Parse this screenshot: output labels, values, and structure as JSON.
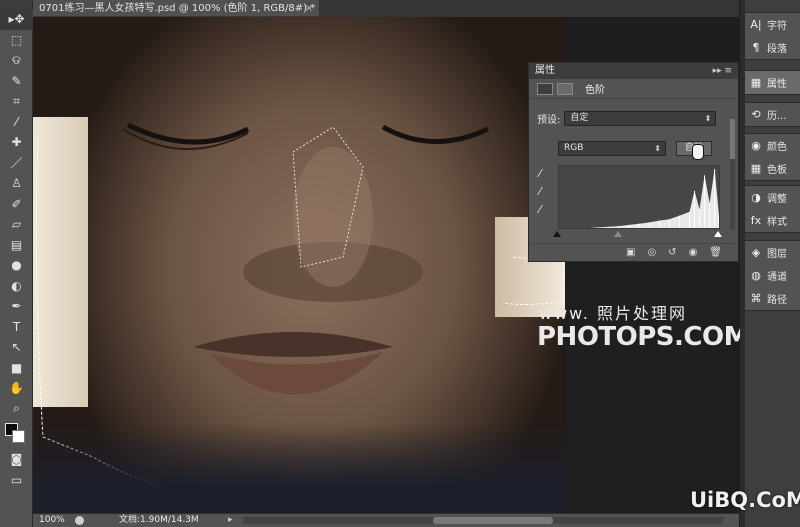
{
  "document": {
    "tab_title": "0701练习—黑人女孩特写.psd @ 100% (色阶 1, RGB/8#) *",
    "close": "×"
  },
  "tools": [
    {
      "icon": "move-icon",
      "glyph": "▸✥"
    },
    {
      "icon": "marquee-icon",
      "glyph": "⬚"
    },
    {
      "icon": "lasso-icon",
      "glyph": "ଡ"
    },
    {
      "icon": "quick-select-icon",
      "glyph": "✎"
    },
    {
      "icon": "crop-icon",
      "glyph": "⌗"
    },
    {
      "icon": "eyedropper-icon",
      "glyph": "⁄"
    },
    {
      "icon": "healing-brush-icon",
      "glyph": "✚"
    },
    {
      "icon": "brush-icon",
      "glyph": "／"
    },
    {
      "icon": "clone-stamp-icon",
      "glyph": "♙"
    },
    {
      "icon": "history-brush-icon",
      "glyph": "✐"
    },
    {
      "icon": "eraser-icon",
      "glyph": "▱"
    },
    {
      "icon": "gradient-icon",
      "glyph": "▤"
    },
    {
      "icon": "blur-icon",
      "glyph": "●"
    },
    {
      "icon": "dodge-icon",
      "glyph": "◐"
    },
    {
      "icon": "pen-icon",
      "glyph": "✒"
    },
    {
      "icon": "type-icon",
      "glyph": "T"
    },
    {
      "icon": "path-select-icon",
      "glyph": "↖"
    },
    {
      "icon": "shape-icon",
      "glyph": "■"
    },
    {
      "icon": "hand-icon",
      "glyph": "✋"
    },
    {
      "icon": "zoom-icon",
      "glyph": "⌕"
    }
  ],
  "extra_tools": [
    {
      "icon": "quick-mask-icon",
      "glyph": "◙"
    },
    {
      "icon": "screen-mode-icon",
      "glyph": "▭"
    }
  ],
  "status": {
    "zoom": "100%",
    "doc_info": "文档:1.90M/14.3M",
    "arrow": "▸"
  },
  "properties": {
    "title": "属性",
    "controls": "▸▸ ≡",
    "type_label": "色阶",
    "preset_label": "预设:",
    "preset_value": "自定",
    "channel_value": "RGB",
    "auto_label": "自动",
    "footer_icons": [
      "clip-icon",
      "view-prev-icon",
      "reset-icon",
      "visibility-icon",
      "trash-icon"
    ],
    "footer_glyphs": [
      "▣",
      "◎",
      "↺",
      "◉",
      "🗑"
    ]
  },
  "chart_data": {
    "type": "area",
    "x": [
      0,
      16,
      32,
      48,
      64,
      80,
      96,
      112,
      128,
      144,
      160,
      176,
      192,
      208,
      216,
      224,
      232,
      240,
      248,
      255
    ],
    "values": [
      0,
      0,
      0,
      0,
      1,
      2,
      3,
      5,
      7,
      9,
      12,
      14,
      20,
      26,
      60,
      30,
      85,
      40,
      95,
      20
    ],
    "ylim": [
      0,
      100
    ]
  },
  "dock": {
    "group1": [
      {
        "icon": "character-icon",
        "glyph": "A|",
        "label": "字符"
      },
      {
        "icon": "paragraph-icon",
        "glyph": "¶",
        "label": "段落"
      }
    ],
    "group2": [
      {
        "icon": "properties-icon",
        "glyph": "▦",
        "label": "属性"
      }
    ],
    "group3": [
      {
        "icon": "history-icon",
        "glyph": "⟲",
        "label": "历..."
      }
    ],
    "group4": [
      {
        "icon": "color-icon",
        "glyph": "◉",
        "label": "颜色"
      },
      {
        "icon": "swatches-icon",
        "glyph": "▦",
        "label": "色板"
      }
    ],
    "group5": [
      {
        "icon": "adjustments-icon",
        "glyph": "◑",
        "label": "调整"
      },
      {
        "icon": "styles-icon",
        "glyph": "fx",
        "label": "样式"
      }
    ],
    "group6": [
      {
        "icon": "layers-icon",
        "glyph": "◈",
        "label": "图层"
      },
      {
        "icon": "channels-icon",
        "glyph": "◍",
        "label": "通道"
      },
      {
        "icon": "paths-icon",
        "glyph": "⌘",
        "label": "路径"
      }
    ]
  },
  "watermark": {
    "line1": "www.  照片处理网",
    "line2": "PHOTOPS.COM"
  },
  "site_watermark": "UiBQ.CoM"
}
